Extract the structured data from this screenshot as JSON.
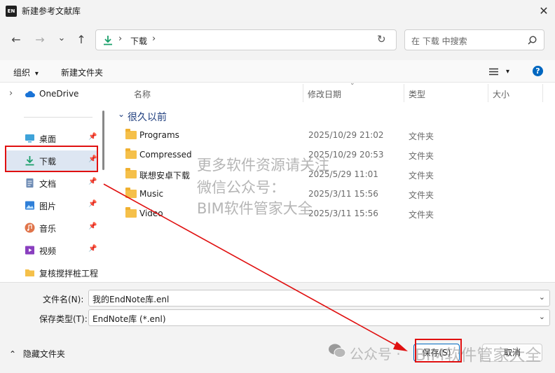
{
  "window": {
    "title": "新建参考文献库",
    "app_icon": "EN",
    "close_glyph": "✕"
  },
  "nav": {
    "back_glyph": "←",
    "forward_glyph": "→",
    "recent_glyph": "⌄",
    "up_glyph": "↑",
    "path_sep": "›",
    "path": "下载",
    "path_dropdown": "›",
    "refresh_glyph": "↻",
    "search_placeholder": "在 下载 中搜索"
  },
  "toolbar": {
    "organize": "组织",
    "organize_arrow": "▾",
    "new_folder": "新建文件夹",
    "view_arrow": "▾",
    "help": "?"
  },
  "sidebar": {
    "expand_glyph": "›",
    "items": [
      {
        "label": "OneDrive",
        "icon": "cloud-icon",
        "pinned": false
      },
      {
        "label": "桌面",
        "icon": "desktop-icon",
        "pinned": true
      },
      {
        "label": "下载",
        "icon": "download-icon",
        "pinned": true,
        "selected": true
      },
      {
        "label": "文档",
        "icon": "document-icon",
        "pinned": true
      },
      {
        "label": "图片",
        "icon": "picture-icon",
        "pinned": true
      },
      {
        "label": "音乐",
        "icon": "music-icon",
        "pinned": true
      },
      {
        "label": "视频",
        "icon": "video-icon",
        "pinned": true
      },
      {
        "label": "复核搅拌桩工程",
        "icon": "folder-icon",
        "pinned": false
      }
    ]
  },
  "columns": [
    "名称",
    "修改日期",
    "类型",
    "大小"
  ],
  "group": {
    "label": "很久以前",
    "glyph": "⌄"
  },
  "files": [
    {
      "name": "Programs",
      "date": "2025/10/29 21:02",
      "type": "文件夹"
    },
    {
      "name": "Compressed",
      "date": "2025/10/29 20:53",
      "type": "文件夹"
    },
    {
      "name": "联想安卓下载",
      "date": "2025/5/29 11:01",
      "type": "文件夹"
    },
    {
      "name": "Music",
      "date": "2025/3/11 15:56",
      "type": "文件夹"
    },
    {
      "name": "Video",
      "date": "2025/3/11 15:56",
      "type": "文件夹"
    }
  ],
  "form": {
    "filename_label": "文件名(N):",
    "filename_value": "我的EndNote库.enl",
    "filetype_label": "保存类型(T):",
    "filetype_value": "EndNote库 (*.enl)",
    "dropdown_glyph": "⌄"
  },
  "footer": {
    "hide_folders_glyph": "⌃",
    "hide_folders": "隐藏文件夹",
    "save": "保存(S)",
    "cancel": "取消"
  },
  "watermarks": {
    "overlay": [
      "更多软件资源请关注",
      "微信公众号：",
      "BIM软件管家大全"
    ],
    "wechat": "公众号 ·",
    "wechat_name": "BIM软件管家大全"
  },
  "annotation_color": "#e01010"
}
